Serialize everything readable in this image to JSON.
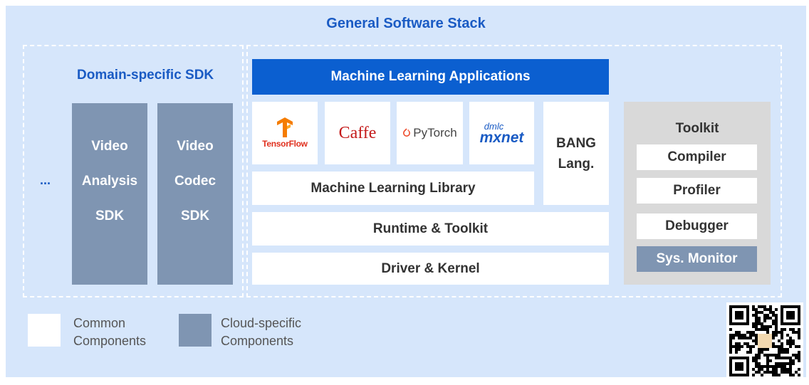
{
  "title": "General Software Stack",
  "domain_sdk": {
    "title": "Domain-specific SDK",
    "ellipsis": "...",
    "boxes": [
      {
        "lines": [
          "Video",
          "Analysis",
          "SDK"
        ]
      },
      {
        "lines": [
          "Video",
          "Codec",
          "SDK"
        ]
      }
    ]
  },
  "stack": {
    "ml_applications": "Machine Learning Applications",
    "frameworks": {
      "tensorflow": "TensorFlow",
      "caffe": "Caffe",
      "pytorch": "PyTorch",
      "mxnet_small": "dmlc",
      "mxnet_big": "mxnet"
    },
    "bang": [
      "BANG",
      "Lang."
    ],
    "ml_library": "Machine Learning Library",
    "runtime": "Runtime & Toolkit",
    "driver": "Driver & Kernel"
  },
  "toolkit": {
    "title": "Toolkit",
    "items": [
      "Compiler",
      "Profiler",
      "Debugger",
      "Sys. Monitor"
    ]
  },
  "legend": [
    {
      "lines": [
        "Common",
        "Components"
      ]
    },
    {
      "lines": [
        "Cloud-specific",
        "Components"
      ]
    }
  ],
  "colors": {
    "background": "#d6e6fb",
    "accent_blue": "#0b5fd0",
    "title_blue": "#1a5bc4",
    "cloud_specific": "#7f95b2",
    "toolkit_panel": "#d9d9d9"
  }
}
